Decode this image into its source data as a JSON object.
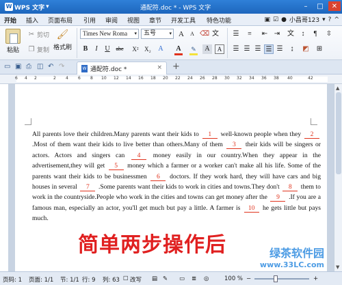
{
  "app": {
    "name": "WPS 文字",
    "window_title": "通配符.doc * - WPS 文字",
    "logo_letter": "W"
  },
  "menu": {
    "tabs": [
      "开始",
      "插入",
      "页面布局",
      "引用",
      "审阅",
      "视图",
      "章节",
      "开发工具",
      "特色功能"
    ],
    "user": "小昌哥123"
  },
  "ribbon": {
    "paste": "粘贴",
    "cut": "剪切",
    "copy": "复制",
    "format_painter": "格式刷",
    "font_name": "Times New Roma",
    "font_size": "五号",
    "bold": "B",
    "italic": "I",
    "underline": "U",
    "strikethrough": "abc",
    "superscript": "X²",
    "subscript": "X₂",
    "font_color_letter": "A",
    "grow_font": "A",
    "shrink_font": "A",
    "char_shading": "A",
    "font_color": "#e0321c",
    "highlight_color": "#f4e23a"
  },
  "tabbar": {
    "doc_tab": "通配符.doc *",
    "close": "×",
    "add": "+"
  },
  "ruler": {
    "numbers": [
      "6",
      "4",
      "2",
      "2",
      "4",
      "6",
      "8",
      "10",
      "12",
      "14",
      "16",
      "18",
      "20",
      "22",
      "24",
      "26",
      "28",
      "30",
      "32",
      "34",
      "36",
      "38",
      "40",
      "42"
    ]
  },
  "document": {
    "segments": [
      {
        "t": "All parents love their children.Many parents want their kids to "
      },
      {
        "b": "1"
      },
      {
        "t": " well-known people when they "
      },
      {
        "b": "2"
      },
      {
        "t": " .Most of them want their kids to live better than others.Many of them "
      },
      {
        "b": "3"
      },
      {
        "t": " their kids will be singers or actors. Actors and singers can "
      },
      {
        "b": "4"
      },
      {
        "t": " money easily in our country.When they appear in the advertisement,they will get "
      },
      {
        "b": "5"
      },
      {
        "t": " money which a farmer or a worker can't make all his life. Some of the parents want their kids to be businessmen "
      },
      {
        "b": "6"
      },
      {
        "t": " doctors. If they work hard, they will have cars and big houses in several "
      },
      {
        "b": "7"
      },
      {
        "t": " .Some parents want their kids to work in cities and towns.They don't "
      },
      {
        "b": "8"
      },
      {
        "t": " them to work in the countryside.People who work in the cities and towns can get money after the "
      },
      {
        "b": "9"
      },
      {
        "t": " .If you are a famous man, especially an actor, you'll get much but pay a little. A farmer is "
      },
      {
        "b": "10"
      },
      {
        "t": " he gets little but pays much."
      }
    ],
    "overlay_caption": "简单两步操作后",
    "watermark_line1": "绿茶软件园",
    "watermark_line2": "www.33LC.com"
  },
  "status": {
    "page": "页码: 1",
    "pages": "页面: 1/1",
    "section": "节: 1/1",
    "row": "行: 9",
    "col": "列: 63",
    "overwrite": "改写",
    "zoom": "100 %"
  },
  "colors": {
    "title_blue": "#1d66bd",
    "blank_red": "#e0321c",
    "caption_red": "#e02020"
  }
}
